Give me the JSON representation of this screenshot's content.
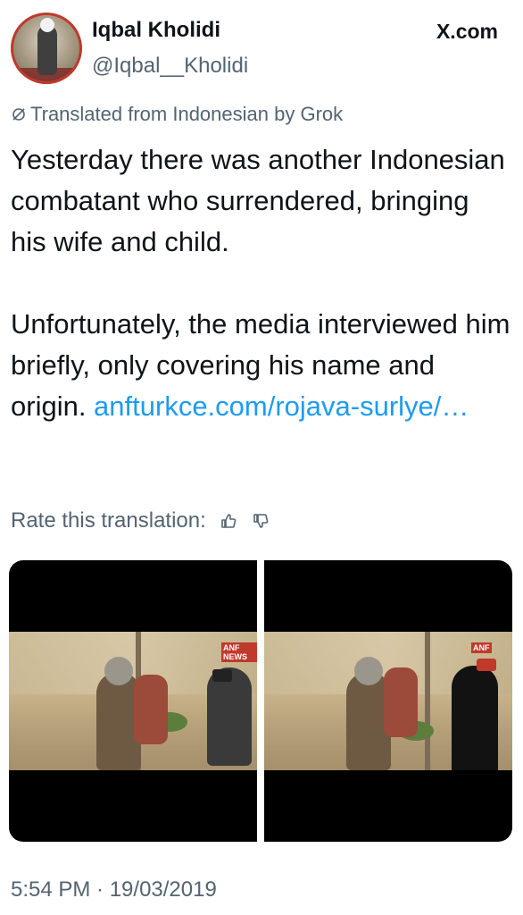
{
  "author": {
    "name": "Iqbal Kholidi",
    "handle": "@Iqbal__Kholidi",
    "avatar_icon": "avatar-photo"
  },
  "site": {
    "label": "X.com",
    "logo_icon": "x-logo-icon"
  },
  "translation": {
    "label": "Translated from Indonesian by Grok",
    "icon": "translate-icon"
  },
  "tweet": {
    "paragraph1": "Yesterday there was another Indonesian combatant who surrendered, bringing his wife and child.",
    "paragraph2_text": "Unfortunately, the media interviewed him briefly, only covering his name and origin. ",
    "paragraph2_link": "anfturkce.com/rojava-surlye/…"
  },
  "rate": {
    "label": "Rate this translation:",
    "thumbs_up_icon": "thumbs-up-icon",
    "thumbs_down_icon": "thumbs-down-icon"
  },
  "media": {
    "images": [
      {
        "watermark": "ANF NEWS"
      },
      {
        "watermark": "ANF"
      }
    ]
  },
  "timestamp": "5:54 PM · 19/03/2019",
  "colors": {
    "link": "#1d9bf0",
    "secondary_text": "#536471",
    "text": "#0f1419"
  }
}
